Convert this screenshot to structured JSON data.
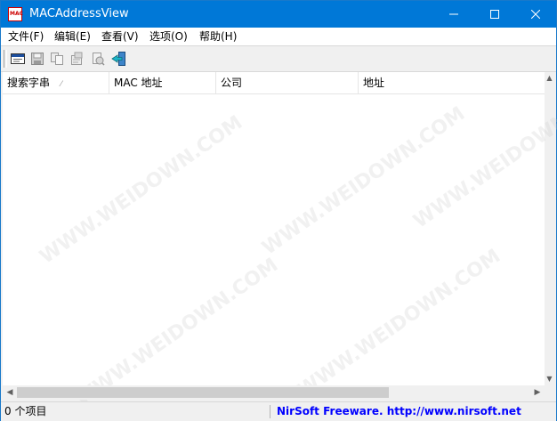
{
  "window": {
    "title": "MACAddressView",
    "icon_text": "MAC"
  },
  "controls": {
    "minimize": "minimize-icon",
    "maximize": "maximize-icon",
    "close": "close-icon"
  },
  "menu": [
    {
      "label": "文件(F)"
    },
    {
      "label": "编辑(E)"
    },
    {
      "label": "查看(V)"
    },
    {
      "label": "选项(O)"
    },
    {
      "label": "帮助(H)"
    }
  ],
  "toolbar": {
    "buttons": [
      "find-icon",
      "save-icon",
      "copy-icon",
      "properties-icon",
      "html-report-icon",
      "exit-icon"
    ]
  },
  "table": {
    "columns": [
      {
        "label": "搜索字串"
      },
      {
        "label": "MAC 地址"
      },
      {
        "label": "公司"
      },
      {
        "label": "地址"
      }
    ],
    "sort_glyph": "⁄",
    "rows": []
  },
  "status": {
    "count": "0 个项目",
    "credit": "NirSoft Freeware.  http://www.nirsoft.net"
  },
  "watermark": "WWW.WEIDOWN.COM",
  "colors": {
    "titlebar": "#0078d7",
    "link": "#0000ff"
  }
}
